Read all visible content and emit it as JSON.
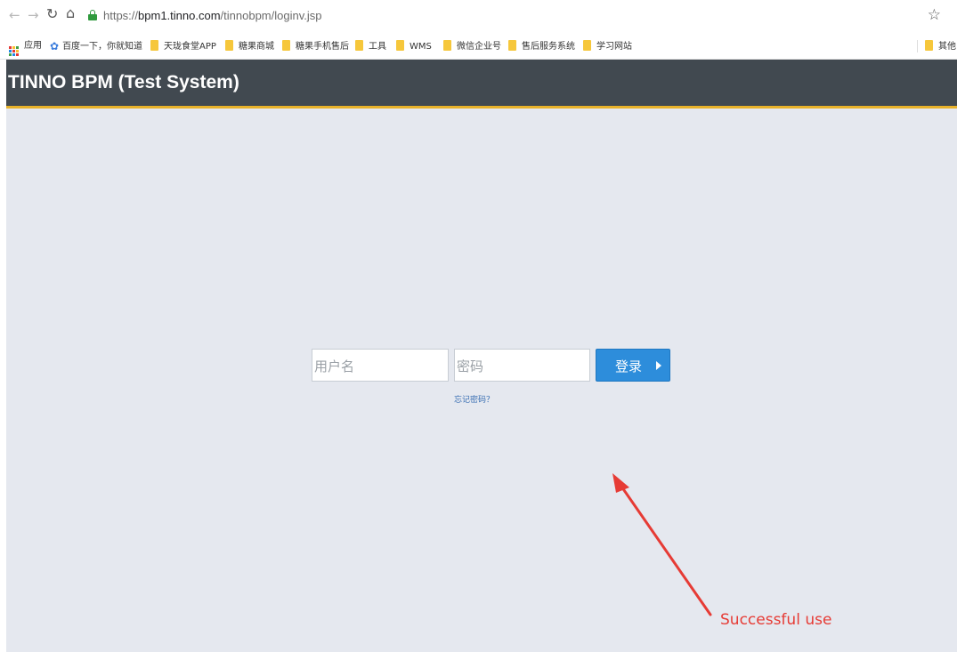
{
  "browser": {
    "url_scheme": "https://",
    "url_host": "bpm1.tinno.com",
    "url_path": "/tinnobpm/loginv.jsp",
    "bookmarks": [
      {
        "label": "应用",
        "icon": "apps-grid-icon"
      },
      {
        "label": "百度一下，你就知道",
        "icon": "baidu-paw-icon"
      },
      {
        "label": "天珑食堂APP",
        "icon": "folder-icon"
      },
      {
        "label": "糖果商城",
        "icon": "folder-icon"
      },
      {
        "label": "糖果手机售后",
        "icon": "folder-icon"
      },
      {
        "label": "工具",
        "icon": "folder-icon"
      },
      {
        "label": "WMS",
        "icon": "folder-icon"
      },
      {
        "label": "微信企业号",
        "icon": "folder-icon"
      },
      {
        "label": "售后服务系统",
        "icon": "folder-icon"
      },
      {
        "label": "学习网站",
        "icon": "folder-icon"
      }
    ],
    "other_bookmarks": "其他"
  },
  "app": {
    "title": "TINNO BPM (Test System)"
  },
  "login": {
    "username_placeholder": "用户名",
    "password_placeholder": "密码",
    "submit_label": "登录",
    "forgot_label": "忘记密码？"
  },
  "annotation": {
    "text": "Successful use",
    "color": "#e63b35"
  },
  "colors": {
    "header_bg": "#414950",
    "header_accent": "#e8b22a",
    "page_bg": "#e5e8ef",
    "button_bg": "#2d8ddb"
  }
}
